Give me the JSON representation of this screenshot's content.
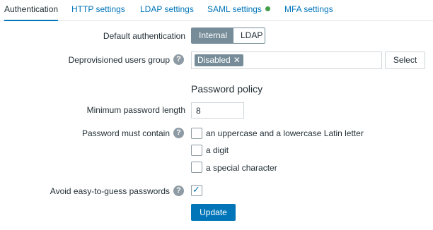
{
  "tabs": [
    {
      "label": "Authentication",
      "active": true
    },
    {
      "label": "HTTP settings"
    },
    {
      "label": "LDAP settings"
    },
    {
      "label": "SAML settings",
      "status_color": "#429e47"
    },
    {
      "label": "MFA settings"
    }
  ],
  "form": {
    "default_auth": {
      "label": "Default authentication",
      "options": [
        "Internal",
        "LDAP"
      ],
      "selected": "Internal"
    },
    "deprovisioned": {
      "label": "Deprovisioned users group",
      "help": "?",
      "tag": "Disabled",
      "remove_icon": "✕",
      "select_button": "Select"
    },
    "password_policy": {
      "title": "Password policy",
      "min_length": {
        "label": "Minimum password length",
        "value": "8"
      },
      "must_contain": {
        "label": "Password must contain",
        "help": "?",
        "options": [
          {
            "label": "an uppercase and a lowercase Latin letter",
            "checked": false
          },
          {
            "label": "a digit",
            "checked": false
          },
          {
            "label": "a special character",
            "checked": false
          }
        ]
      },
      "avoid_easy": {
        "label": "Avoid easy-to-guess passwords",
        "help": "?",
        "checked": true,
        "check_glyph": "✓"
      }
    },
    "update_button": "Update"
  },
  "colors": {
    "accent": "#0275b8",
    "segment_active": "#768d99",
    "status_ok": "#429e47"
  }
}
